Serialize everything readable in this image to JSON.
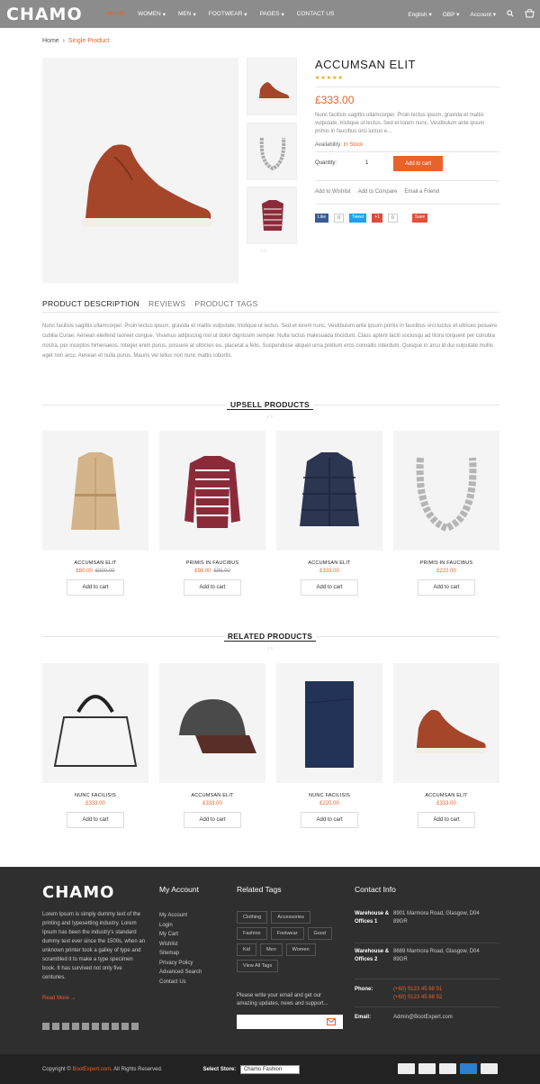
{
  "header": {
    "logo": "CHAMO",
    "nav": [
      {
        "label": "HOME",
        "active": true
      },
      {
        "label": "WOMEN",
        "active": false,
        "caret": "▾"
      },
      {
        "label": "MEN",
        "active": false,
        "caret": "▾"
      },
      {
        "label": "FOOTWEAR",
        "active": false,
        "caret": "▾"
      },
      {
        "label": "PAGES",
        "active": false,
        "caret": "▾"
      },
      {
        "label": "CONTACT US",
        "active": false
      }
    ],
    "language": "English",
    "currency": "GBP",
    "account": "Account",
    "accent": "#e8632b"
  },
  "breadcrumb": {
    "home": "Home",
    "sep": "›",
    "current": "Single Product"
  },
  "product": {
    "title": "ACCUMSAN ELIT",
    "stars": "★★★★★",
    "price": "£333.00",
    "desc": "Nunc facilisis sagittis ullamcorper. Proin lectus ipsum, gravida et mattis vulputate, tristique ut lectus. Sed et lorem nunc. Vestibulum ante ipsum primis in faucibus orci luctus e...",
    "availability_label": "Availability:",
    "availability_value": "In Stock",
    "quantity_label": "Quantity:",
    "quantity": "1",
    "add_to_cart": "Add to cart",
    "wishlist": "Add to Wishlist",
    "compare": "Add to Compare",
    "email": "Email a Friend",
    "social": [
      {
        "label": "Like",
        "color": "#3b5998"
      },
      {
        "label": "0",
        "color": "#bbb"
      },
      {
        "label": "Tweet",
        "color": "#1da1f2"
      },
      {
        "label": "+1",
        "color": "#dd4b39"
      },
      {
        "label": "0",
        "color": "#bbb"
      },
      {
        "label": "Save",
        "color": "#e0503a"
      }
    ]
  },
  "tabs": {
    "items": [
      "PRODUCT DESCRIPTION",
      "REVIEWS",
      "PRODUCT TAGS"
    ],
    "text": "Nunc facilisis sagittis ullamcorper. Proin lectus ipsum, gravida et mattis vulputate, tristique ut lectus. Sed et lorem nunc. Vestibulum ante ipsum primis in faucibus orci luctus et ultrices posuere cubilia Curae; Aenean eleifend laoreet congue. Vivamus adipiscing nisl ut dolor dignissim semper. Nulla luctus malesuada tincidunt. Class aptent taciti sociosqu ad litora torquent per conubia nostra, per inceptos himenaeos. Integer enim purus, posuere at ultricies eu, placerat a felis. Suspendisse aliquet urna pretium eros convallis interdum. Quisque in arcu id dui vulputate mollis eget non arcu. Aenean et nulla purus. Mauris vel tellus non nunc mattis lobortis."
  },
  "upsell": {
    "title": "UPSELL PRODUCTS",
    "dots": "‹ ›",
    "items": [
      {
        "name": "ACCUMSAN ELIT",
        "price": "£60.00",
        "old": "£900.00",
        "icon": "trench-coat"
      },
      {
        "name": "PRIMIS IN FAUCIBUS",
        "price": "£98.00",
        "old": "£95.00",
        "icon": "striped-shirt"
      },
      {
        "name": "ACCUMSAN ELIT",
        "price": "£333.00",
        "old": "",
        "icon": "puffer-jacket"
      },
      {
        "name": "PRIMIS IN FAUCIBUS",
        "price": "£222.00",
        "old": "",
        "icon": "necklace"
      }
    ],
    "btn": "Add to cart"
  },
  "related": {
    "title": "RELATED PRODUCTS",
    "dots": "‹ ›",
    "items": [
      {
        "name": "NUNC FACILISIS",
        "price": "£333.00",
        "icon": "handbag"
      },
      {
        "name": "ACCUMSAN ELIT",
        "price": "£333.00",
        "icon": "cap"
      },
      {
        "name": "NUNC FACILISIS",
        "price": "£220.00",
        "icon": "folded-cloth"
      },
      {
        "name": "ACCUMSAN ELIT",
        "price": "£333.00",
        "icon": "sneaker"
      }
    ],
    "btn": "Add to cart"
  },
  "footer": {
    "logo": "CHAMO",
    "about": "Lorem Ipsum is simply dummy text of the printing and typesetting industry. Lorem Ipsum has been the industry's standard dummy text ever since the 1500s, when an unknown printer took a galley of type and scrambled it to make a type specimen book. It has survived not only five centuries.",
    "read_more": "Read More →",
    "account_title": "My Account",
    "account_links": [
      "My Account",
      "Login",
      "My Cart",
      "Wishlist",
      "Sitemap",
      "Privacy Policy",
      "Advanced Search",
      "Contact Us"
    ],
    "tags_title": "Related Tags",
    "tags": [
      "Clothing",
      "Accessories",
      "Fashion",
      "Footwear",
      "Good",
      "Kid",
      "Men",
      "Women",
      "View All Tags"
    ],
    "newsletter": "Please write your email and get our amazing updates, news and support...",
    "contact_title": "Contact Info",
    "w1_label": "Warehouse & Offices 1",
    "w1_addr": "8901 Marmora Road, Glasgow, D04 89GR",
    "w2_label": "Warehouse & Offices 2",
    "w2_addr": "8689 Marmora Road, Glasgow, D04 89GR",
    "phone_label": "Phone:",
    "phone1": "(+60) 0123 45 68 91",
    "phone2": "(+60) 0123 45 68 92",
    "email_label": "Email:",
    "email": "Admin@BootExpert.com",
    "copyright_pre": "Copyright ©",
    "copyright_brand": "BootExpert.com",
    "copyright_post": ". All Rights Reserved.",
    "store_label": "Select Store:",
    "store_value": "Chamo Fashion"
  }
}
